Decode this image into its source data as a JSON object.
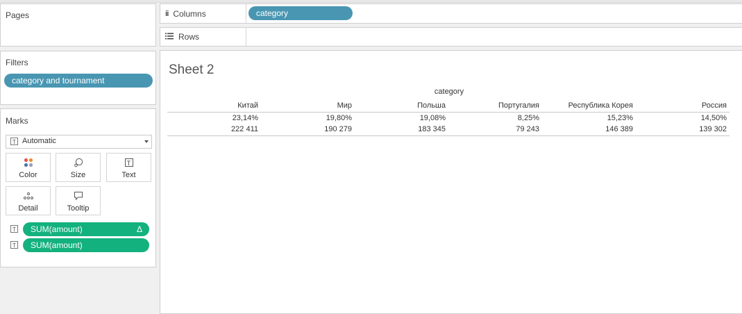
{
  "pages_panel": {
    "title": "Pages"
  },
  "filters_panel": {
    "title": "Filters",
    "pills": [
      "category and tournament"
    ]
  },
  "marks_panel": {
    "title": "Marks",
    "mark_type": "Automatic",
    "buttons": [
      "Color",
      "Size",
      "Text",
      "Detail",
      "Tooltip"
    ],
    "fields": [
      {
        "label": "SUM(amount)",
        "delta": "Δ"
      },
      {
        "label": "SUM(amount)"
      }
    ]
  },
  "columns_shelf": {
    "label": "Columns",
    "pill": "category"
  },
  "rows_shelf": {
    "label": "Rows"
  },
  "sheet": {
    "title": "Sheet 2",
    "column_header": "category",
    "columns": [
      "Китай",
      "Мир",
      "Польша",
      "Португалия",
      "Республика Корея",
      "Россия"
    ],
    "rows": [
      [
        "23,14%",
        "19,80%",
        "19,08%",
        "8,25%",
        "15,23%",
        "14,50%"
      ],
      [
        "222 411",
        "190 279",
        "183 345",
        "79 243",
        "146 389",
        "139 302"
      ]
    ]
  },
  "colors": {
    "pill_blue": "#4996b2",
    "pill_green": "#13b17d"
  }
}
